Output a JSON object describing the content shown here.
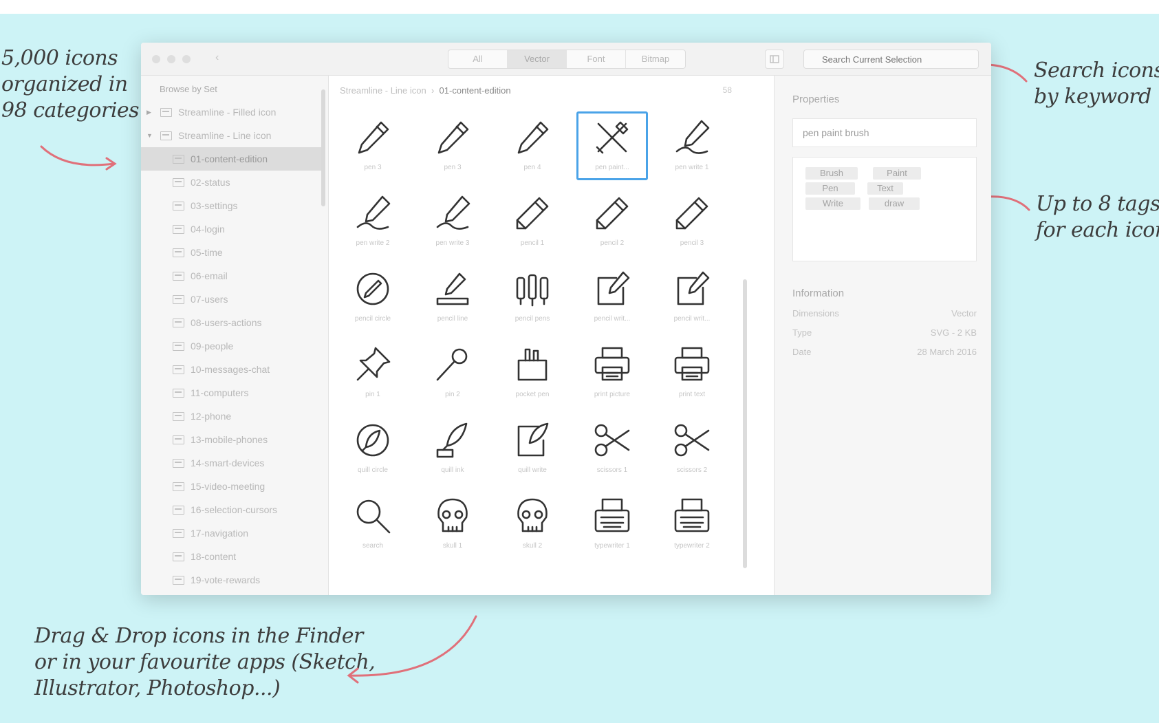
{
  "annotations": {
    "top_left": [
      "5,000 icons",
      "organized in",
      "98 categories"
    ],
    "top_right": [
      "Search icons",
      "by keyword"
    ],
    "mid_right": [
      "Up to 8 tags",
      "for each icon"
    ],
    "bottom": [
      "Drag & Drop icons in the Finder",
      "or in your favourite apps (Sketch,",
      "Illustrator, Photoshop...)"
    ],
    "arrow_color": "#e0707a"
  },
  "toolbar": {
    "segments": [
      "All",
      "Vector",
      "Font",
      "Bitmap"
    ],
    "active_segment": "Vector",
    "search_placeholder": "Search Current Selection",
    "nav_arrow": "‹"
  },
  "sidebar": {
    "heading": "Browse by Set",
    "sets": [
      {
        "label": "Streamline - Filled icon",
        "expanded": false
      },
      {
        "label": "Streamline - Line icon",
        "expanded": true
      }
    ],
    "items": [
      "01-content-edition",
      "02-status",
      "03-settings",
      "04-login",
      "05-time",
      "06-email",
      "07-users",
      "08-users-actions",
      "09-people",
      "10-messages-chat",
      "11-computers",
      "12-phone",
      "13-mobile-phones",
      "14-smart-devices",
      "15-video-meeting",
      "16-selection-cursors",
      "17-navigation",
      "18-content",
      "19-vote-rewards"
    ],
    "active_item": "01-content-edition"
  },
  "center": {
    "breadcrumb_root": "Streamline - Line icon",
    "breadcrumb_sep": "›",
    "breadcrumb_current": "01-content-edition",
    "breadcrumb_end": "58",
    "icons": [
      {
        "label": "pen 3",
        "icon": "pen-icon"
      },
      {
        "label": "pen 3",
        "icon": "pen-icon"
      },
      {
        "label": "pen 4",
        "icon": "pen-icon"
      },
      {
        "label": "pen paint...",
        "icon": "pen-paint-brush-icon",
        "selected": true
      },
      {
        "label": "pen write 1",
        "icon": "pen-write-icon"
      },
      {
        "label": "pen write 2",
        "icon": "pen-write-icon"
      },
      {
        "label": "pen write 3",
        "icon": "pen-write-icon"
      },
      {
        "label": "pencil 1",
        "icon": "pencil-icon"
      },
      {
        "label": "pencil 2",
        "icon": "pencil-icon"
      },
      {
        "label": "pencil 3",
        "icon": "pencil-icon"
      },
      {
        "label": "pencil circle",
        "icon": "pencil-circle-icon"
      },
      {
        "label": "pencil line",
        "icon": "pencil-line-icon"
      },
      {
        "label": "pencil pens",
        "icon": "pencil-pens-icon"
      },
      {
        "label": "pencil writ...",
        "icon": "pencil-write-icon"
      },
      {
        "label": "pencil writ...",
        "icon": "pencil-write-icon"
      },
      {
        "label": "pin 1",
        "icon": "pushpin-icon"
      },
      {
        "label": "pin 2",
        "icon": "map-pin-icon"
      },
      {
        "label": "pocket pen",
        "icon": "pocket-pen-icon"
      },
      {
        "label": "print picture",
        "icon": "printer-icon"
      },
      {
        "label": "print text",
        "icon": "printer-icon"
      },
      {
        "label": "quill circle",
        "icon": "quill-circle-icon"
      },
      {
        "label": "quill ink",
        "icon": "quill-ink-icon"
      },
      {
        "label": "quill write",
        "icon": "quill-write-icon"
      },
      {
        "label": "scissors 1",
        "icon": "scissors-icon"
      },
      {
        "label": "scissors 2",
        "icon": "scissors-icon"
      },
      {
        "label": "search",
        "icon": "search-icon"
      },
      {
        "label": "skull 1",
        "icon": "skull-icon"
      },
      {
        "label": "skull 2",
        "icon": "skull-icon"
      },
      {
        "label": "typewriter 1",
        "icon": "typewriter-icon"
      },
      {
        "label": "typewriter 2",
        "icon": "typewriter-icon"
      }
    ]
  },
  "properties": {
    "heading": "Properties",
    "name_value": "pen paint brush",
    "tags": [
      "Brush",
      "Paint",
      "Pen",
      "Text",
      "Write",
      "draw"
    ]
  },
  "information": {
    "heading": "Information",
    "rows": [
      {
        "label": "Dimensions",
        "value": "Vector"
      },
      {
        "label": "Type",
        "value": "SVG - 2 KB"
      },
      {
        "label": "Date",
        "value": "28 March 2016"
      }
    ]
  }
}
